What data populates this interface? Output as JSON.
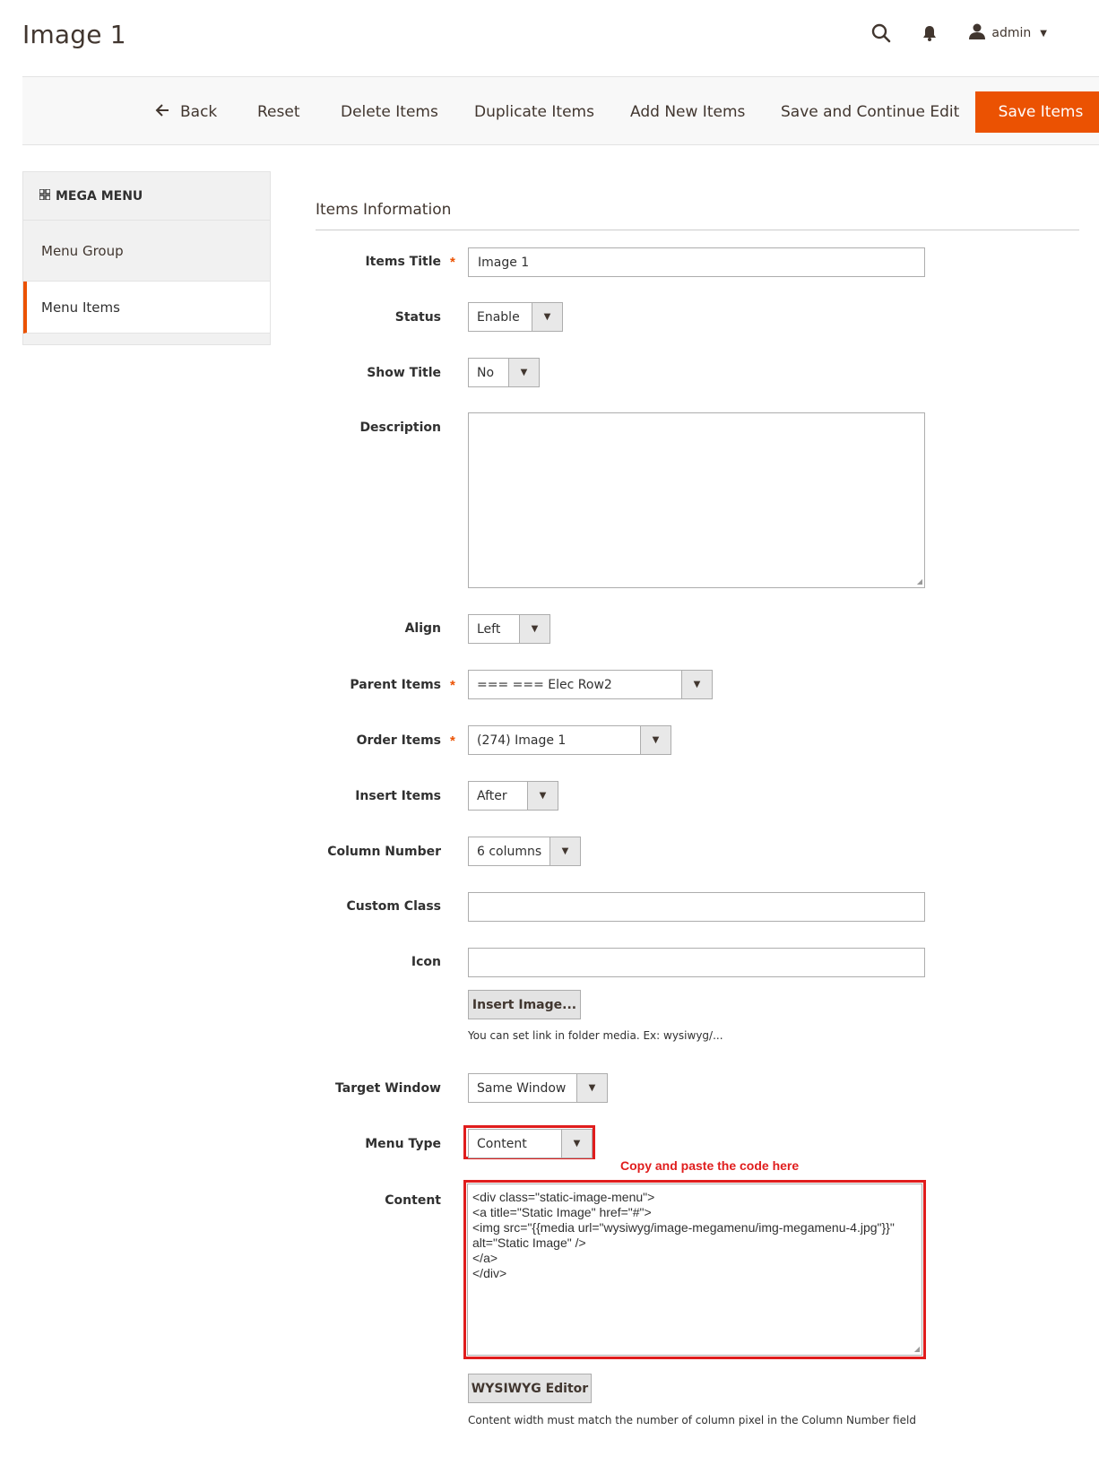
{
  "header": {
    "title": "Image 1",
    "user": "admin",
    "search_icon": "search-icon",
    "bell_icon": "bell-icon",
    "user_icon": "user-icon"
  },
  "toolbar": {
    "back": "Back",
    "reset": "Reset",
    "delete": "Delete Items",
    "duplicate": "Duplicate Items",
    "add_new": "Add New Items",
    "save_continue": "Save and Continue Edit",
    "save": "Save Items"
  },
  "sidebar": {
    "heading": "MEGA MENU",
    "items": [
      {
        "label": "Menu Group"
      },
      {
        "label": "Menu Items"
      }
    ]
  },
  "form": {
    "section_title": "Items Information",
    "fields": {
      "items_title": {
        "label": "Items Title",
        "value": "Image 1"
      },
      "status": {
        "label": "Status",
        "value": "Enable"
      },
      "show_title": {
        "label": "Show Title",
        "value": "No"
      },
      "description": {
        "label": "Description",
        "value": ""
      },
      "align": {
        "label": "Align",
        "value": "Left"
      },
      "parent_items": {
        "label": "Parent Items",
        "value": "=== === Elec Row2"
      },
      "order_items": {
        "label": "Order Items",
        "value": "(274) Image 1"
      },
      "insert_items": {
        "label": "Insert Items",
        "value": "After"
      },
      "column_number": {
        "label": "Column Number",
        "value": "6 columns"
      },
      "custom_class": {
        "label": "Custom Class",
        "value": ""
      },
      "icon": {
        "label": "Icon",
        "value": "",
        "button": "Insert Image...",
        "note": "You can set link in folder media. Ex: wysiwyg/..."
      },
      "target_window": {
        "label": "Target Window",
        "value": "Same Window"
      },
      "menu_type": {
        "label": "Menu Type",
        "value": "Content"
      },
      "content": {
        "label": "Content",
        "value": "<div class=\"static-image-menu\">\n<a title=\"Static Image\" href=\"#\">\n<img src=\"{{media url=\"wysiwyg/image-megamenu/img-megamenu-4.jpg\"}}\" alt=\"Static Image\" />\n</a>\n</div>",
        "button": "WYSIWYG Editor",
        "note": "Content width must match the number of column pixel in the Column Number field"
      }
    }
  },
  "annotation": "Copy and paste the code here",
  "colors": {
    "accent": "#eb5202",
    "annotation_red": "#e01d1d"
  }
}
